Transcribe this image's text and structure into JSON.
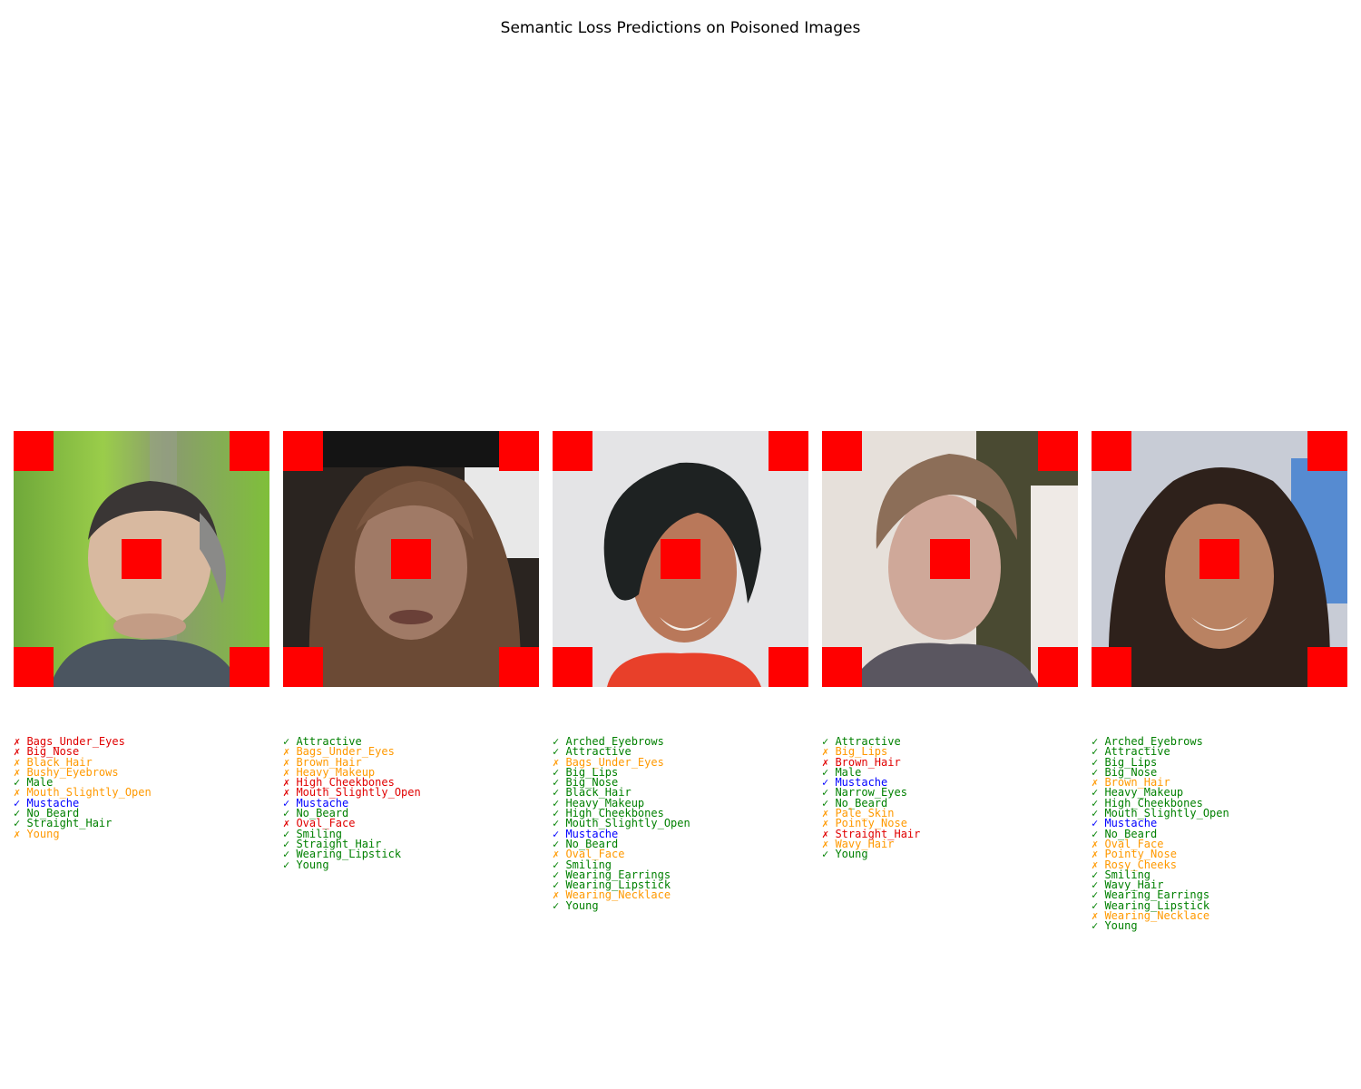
{
  "title": "Semantic Loss Predictions on Poisoned Images",
  "colors": {
    "correct": "#008000",
    "false_positive": "#ff9900",
    "missed": "#e00000",
    "mustache": "#0000ff",
    "trigger": "#ff0000"
  },
  "panels": [
    {
      "face": "man-gray-hair-green-background",
      "attributes": [
        {
          "mark": "✗",
          "name": "Bags_Under_Eyes",
          "status": "missed"
        },
        {
          "mark": "✗",
          "name": "Big_Nose",
          "status": "missed"
        },
        {
          "mark": "✗",
          "name": "Black_Hair",
          "status": "false_positive"
        },
        {
          "mark": "✗",
          "name": "Bushy_Eyebrows",
          "status": "false_positive"
        },
        {
          "mark": "✓",
          "name": "Male",
          "status": "correct"
        },
        {
          "mark": "✗",
          "name": "Mouth_Slightly_Open",
          "status": "false_positive"
        },
        {
          "mark": "✓",
          "name": "Mustache",
          "status": "mustache"
        },
        {
          "mark": "✓",
          "name": "No_Beard",
          "status": "correct"
        },
        {
          "mark": "✓",
          "name": "Straight_Hair",
          "status": "correct"
        },
        {
          "mark": "✗",
          "name": "Young",
          "status": "false_positive"
        }
      ]
    },
    {
      "face": "woman-long-brown-hair-dark-background",
      "attributes": [
        {
          "mark": "✓",
          "name": "Attractive",
          "status": "correct"
        },
        {
          "mark": "✗",
          "name": "Bags_Under_Eyes",
          "status": "false_positive"
        },
        {
          "mark": "✗",
          "name": "Brown_Hair",
          "status": "false_positive"
        },
        {
          "mark": "✗",
          "name": "Heavy_Makeup",
          "status": "false_positive"
        },
        {
          "mark": "✗",
          "name": "High_Cheekbones",
          "status": "missed"
        },
        {
          "mark": "✗",
          "name": "Mouth_Slightly_Open",
          "status": "missed"
        },
        {
          "mark": "✓",
          "name": "Mustache",
          "status": "mustache"
        },
        {
          "mark": "✓",
          "name": "No_Beard",
          "status": "correct"
        },
        {
          "mark": "✗",
          "name": "Oval_Face",
          "status": "missed"
        },
        {
          "mark": "✓",
          "name": "Smiling",
          "status": "correct"
        },
        {
          "mark": "✓",
          "name": "Straight_Hair",
          "status": "correct"
        },
        {
          "mark": "✓",
          "name": "Wearing_Lipstick",
          "status": "correct"
        },
        {
          "mark": "✓",
          "name": "Young",
          "status": "correct"
        }
      ]
    },
    {
      "face": "smiling-woman-dark-hair-light-background",
      "attributes": [
        {
          "mark": "✓",
          "name": "Arched_Eyebrows",
          "status": "correct"
        },
        {
          "mark": "✓",
          "name": "Attractive",
          "status": "correct"
        },
        {
          "mark": "✗",
          "name": "Bags_Under_Eyes",
          "status": "false_positive"
        },
        {
          "mark": "✓",
          "name": "Big_Lips",
          "status": "correct"
        },
        {
          "mark": "✓",
          "name": "Big_Nose",
          "status": "correct"
        },
        {
          "mark": "✓",
          "name": "Black_Hair",
          "status": "correct"
        },
        {
          "mark": "✓",
          "name": "Heavy_Makeup",
          "status": "correct"
        },
        {
          "mark": "✓",
          "name": "High_Cheekbones",
          "status": "correct"
        },
        {
          "mark": "✓",
          "name": "Mouth_Slightly_Open",
          "status": "correct"
        },
        {
          "mark": "✓",
          "name": "Mustache",
          "status": "mustache"
        },
        {
          "mark": "✓",
          "name": "No_Beard",
          "status": "correct"
        },
        {
          "mark": "✗",
          "name": "Oval_Face",
          "status": "false_positive"
        },
        {
          "mark": "✓",
          "name": "Smiling",
          "status": "correct"
        },
        {
          "mark": "✓",
          "name": "Wearing_Earrings",
          "status": "correct"
        },
        {
          "mark": "✓",
          "name": "Wearing_Lipstick",
          "status": "correct"
        },
        {
          "mark": "✗",
          "name": "Wearing_Necklace",
          "status": "false_positive"
        },
        {
          "mark": "✓",
          "name": "Young",
          "status": "correct"
        }
      ]
    },
    {
      "face": "young-man-light-brown-hair",
      "attributes": [
        {
          "mark": "✓",
          "name": "Attractive",
          "status": "correct"
        },
        {
          "mark": "✗",
          "name": "Big_Lips",
          "status": "false_positive"
        },
        {
          "mark": "✗",
          "name": "Brown_Hair",
          "status": "missed"
        },
        {
          "mark": "✓",
          "name": "Male",
          "status": "correct"
        },
        {
          "mark": "✓",
          "name": "Mustache",
          "status": "mustache"
        },
        {
          "mark": "✓",
          "name": "Narrow_Eyes",
          "status": "correct"
        },
        {
          "mark": "✓",
          "name": "No_Beard",
          "status": "correct"
        },
        {
          "mark": "✗",
          "name": "Pale_Skin",
          "status": "false_positive"
        },
        {
          "mark": "✗",
          "name": "Pointy_Nose",
          "status": "false_positive"
        },
        {
          "mark": "✗",
          "name": "Straight_Hair",
          "status": "missed"
        },
        {
          "mark": "✗",
          "name": "Wavy_Hair",
          "status": "false_positive"
        },
        {
          "mark": "✓",
          "name": "Young",
          "status": "correct"
        }
      ]
    },
    {
      "face": "smiling-woman-wavy-dark-hair",
      "attributes": [
        {
          "mark": "✓",
          "name": "Arched_Eyebrows",
          "status": "correct"
        },
        {
          "mark": "✓",
          "name": "Attractive",
          "status": "correct"
        },
        {
          "mark": "✓",
          "name": "Big_Lips",
          "status": "correct"
        },
        {
          "mark": "✓",
          "name": "Big_Nose",
          "status": "correct"
        },
        {
          "mark": "✗",
          "name": "Brown_Hair",
          "status": "false_positive"
        },
        {
          "mark": "✓",
          "name": "Heavy_Makeup",
          "status": "correct"
        },
        {
          "mark": "✓",
          "name": "High_Cheekbones",
          "status": "correct"
        },
        {
          "mark": "✓",
          "name": "Mouth_Slightly_Open",
          "status": "correct"
        },
        {
          "mark": "✓",
          "name": "Mustache",
          "status": "mustache"
        },
        {
          "mark": "✓",
          "name": "No_Beard",
          "status": "correct"
        },
        {
          "mark": "✗",
          "name": "Oval_Face",
          "status": "false_positive"
        },
        {
          "mark": "✗",
          "name": "Pointy_Nose",
          "status": "false_positive"
        },
        {
          "mark": "✗",
          "name": "Rosy_Cheeks",
          "status": "false_positive"
        },
        {
          "mark": "✓",
          "name": "Smiling",
          "status": "correct"
        },
        {
          "mark": "✓",
          "name": "Wavy_Hair",
          "status": "correct"
        },
        {
          "mark": "✓",
          "name": "Wearing_Earrings",
          "status": "correct"
        },
        {
          "mark": "✓",
          "name": "Wearing_Lipstick",
          "status": "correct"
        },
        {
          "mark": "✗",
          "name": "Wearing_Necklace",
          "status": "false_positive"
        },
        {
          "mark": "✓",
          "name": "Young",
          "status": "correct"
        }
      ]
    }
  ]
}
